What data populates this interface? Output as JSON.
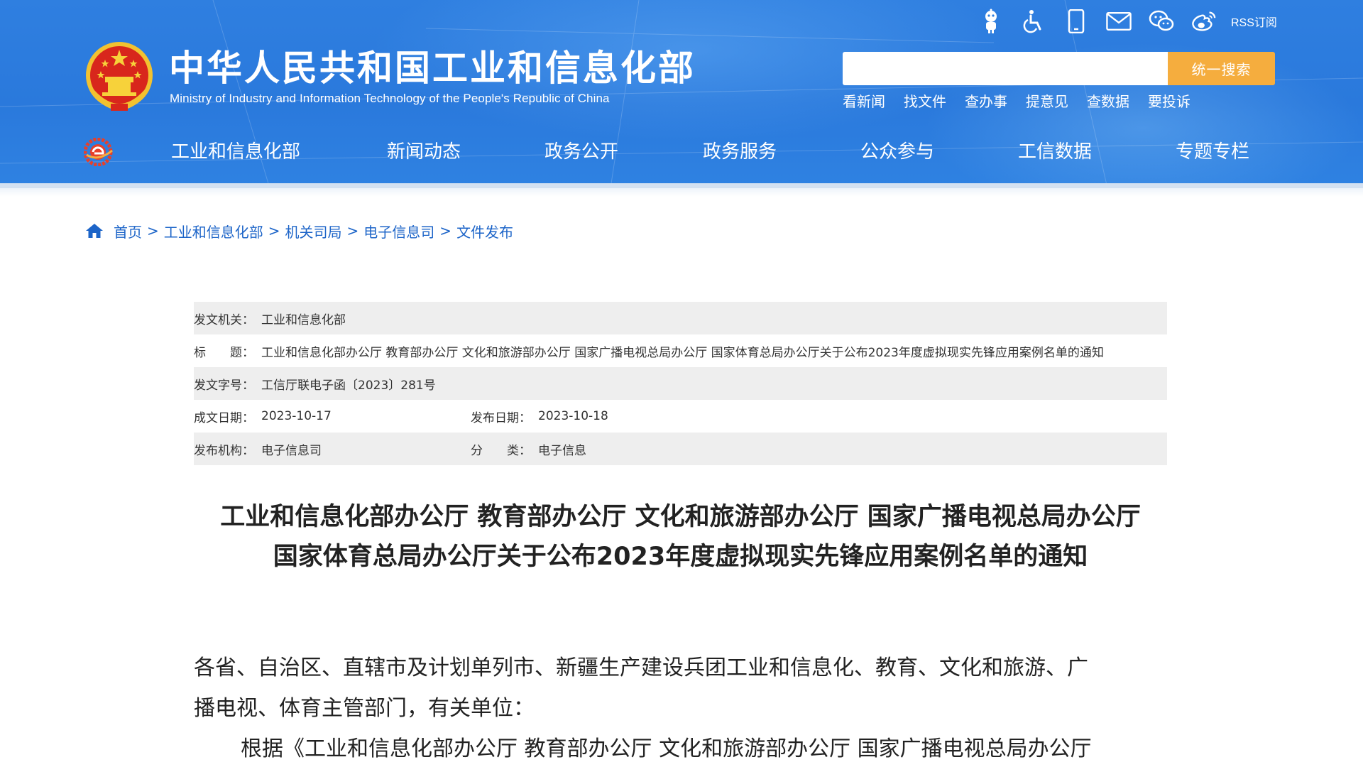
{
  "header": {
    "site_title": "中华人民共和国工业和信息化部",
    "site_subtitle": "Ministry of Industry and Information Technology of the People's Republic of China",
    "rss_label": "RSS订阅",
    "search": {
      "placeholder": "",
      "button_label": "统一搜索"
    },
    "quick_links": [
      "看新闻",
      "找文件",
      "查办事",
      "提意见",
      "查数据",
      "要投诉"
    ],
    "nav": [
      "工业和信息化部",
      "新闻动态",
      "政务公开",
      "政务服务",
      "公众参与",
      "工信数据",
      "专题专栏"
    ],
    "colors": {
      "header_blue": "#2f7fe0",
      "search_button": "#f5ad3e",
      "link_blue": "#1c64c8"
    }
  },
  "breadcrumb": [
    "首页",
    "工业和信息化部",
    "机关司局",
    "电子信息司",
    "文件发布"
  ],
  "meta": {
    "issuer_label": "发文机关：",
    "issuer": "工业和信息化部",
    "title_label": "标　　题：",
    "title": "工业和信息化部办公厅 教育部办公厅 文化和旅游部办公厅 国家广播电视总局办公厅 国家体育总局办公厅关于公布2023年度虚拟现实先锋应用案例名单的通知",
    "doc_no_label": "发文字号：",
    "doc_no": "工信厅联电子函〔2023〕281号",
    "written_date_label": "成文日期：",
    "written_date": "2023-10-17",
    "publish_date_label": "发布日期：",
    "publish_date": "2023-10-18",
    "publisher_label": "发布机构：",
    "publisher": "电子信息司",
    "category_label": "分　　类：",
    "category": "电子信息"
  },
  "article": {
    "title_line1": "工业和信息化部办公厅 教育部办公厅 文化和旅游部办公厅 国家广播电视总局办公厅",
    "title_line2": "国家体育总局办公厅关于公布2023年度虚拟现实先锋应用案例名单的通知",
    "salutation_line1": "各省、自治区、直辖市及计划单列市、新疆生产建设兵团工业和信息化、教育、文化和旅游、广",
    "salutation_line2": "播电视、体育主管部门，有关单位：",
    "para1_line1": "根据《工业和信息化部办公厅 教育部办公厅 文化和旅游部办公厅 国家广播电视总局办公厅"
  }
}
